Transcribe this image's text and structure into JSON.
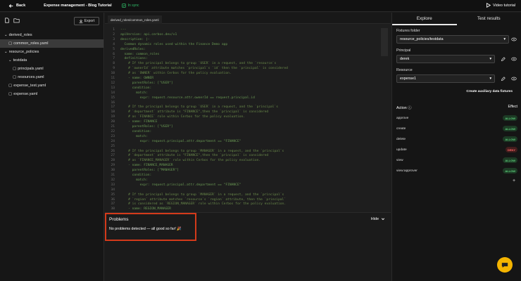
{
  "topbar": {
    "back_label": "Back",
    "title": "Expense management - Blog Tutorial",
    "sync_status": "In sync",
    "video_label": "Video tutorial"
  },
  "sidebar": {
    "export_label": "Export",
    "tree": [
      {
        "label": "derived_roles",
        "type": "folder",
        "depth": 0
      },
      {
        "label": "common_roles.yaml",
        "type": "file",
        "depth": 1,
        "selected": true
      },
      {
        "label": "resource_policies",
        "type": "folder",
        "depth": 0
      },
      {
        "label": "testdata",
        "type": "folder",
        "depth": 1
      },
      {
        "label": "principals.yaml",
        "type": "file",
        "depth": 2
      },
      {
        "label": "resources.yaml",
        "type": "file",
        "depth": 2
      },
      {
        "label": "expense_test.yaml",
        "type": "file",
        "depth": 1
      },
      {
        "label": "expense.yaml",
        "type": "file",
        "depth": 1
      }
    ]
  },
  "editor": {
    "tab_label": "derived_roles/common_roles.yaml",
    "lines": [
      "---",
      "apiVersion: api.cerbos.dev/v1",
      "description: |-",
      "  Common dynamic roles used within the Finance Demo app",
      "derivedRoles:",
      "  name: common_roles",
      "  definitions:",
      "    # If the principal belongs to group `USER` in a request, and the `resource`s",
      "    # `ownerId` attribute matches `principal`s `id` then the `principal` is considered",
      "    # as `OWNER` within Cerbos for the policy evaluation.",
      "    - name: OWNER",
      "      parentRoles: [\"USER\"]",
      "      condition:",
      "        match:",
      "          expr: request.resource.attr.ownerId == request.principal.id",
      "",
      "    # If the principal belongs to group `USER` in a request, and the `principal`s",
      "    # `department` attribute is \"FINANCE\",then the `principal` is considered",
      "    # as `FINANCE` role within Cerbos for the policy evaluation.",
      "    - name: FINANCE",
      "      parentRoles: [\"USER\"]",
      "      condition:",
      "        match:",
      "          expr: request.principal.attr.department == \"FINANCE\"",
      "",
      "    # If the principal belongs to group `MANAGER` in a request, and the `principal`s",
      "    # `department` attribute is \"FINANCE\",then the `principal` is considered",
      "    # as `FINANCE_MANAGER` role within Cerbos for the policy evaluation.",
      "    - name: FINANCE_MANAGER",
      "      parentRoles: [\"MANAGER\"]",
      "      condition:",
      "        match:",
      "          expr: request.principal.attr.department == \"FINANCE\"",
      "",
      "    # If the principal belongs to group `MANAGER` in a request, and the `principal`s",
      "    # `region` attribute matches `resource`s `region` attribute, then the `principal`",
      "    # is considered as `REGION_MANAGER` role within Cerbos for the policy evaluation.",
      "    - name: REGION_MANAGER"
    ]
  },
  "problems": {
    "title": "Problems",
    "hide_label": "Hide",
    "message": "No problems detected — all good so far! 🎉"
  },
  "right": {
    "tabs": [
      "Explore",
      "Test results"
    ],
    "fixtures_label": "Fixtures folder",
    "fixtures_value": "resource_policies/testdata",
    "principal_label": "Principal",
    "principal_value": "derek",
    "resource_label": "Resource",
    "resource_value": "expense1",
    "aux_link": "Create auxiliary data fixtures",
    "action_header": "Action",
    "effect_header": "Effect",
    "actions": [
      {
        "name": "approve",
        "effect": "ALLOW"
      },
      {
        "name": "create",
        "effect": "ALLOW"
      },
      {
        "name": "delete",
        "effect": "ALLOW"
      },
      {
        "name": "update",
        "effect": "DENY"
      },
      {
        "name": "view",
        "effect": "ALLOW"
      },
      {
        "name": "view:approver",
        "effect": "ALLOW"
      }
    ]
  }
}
